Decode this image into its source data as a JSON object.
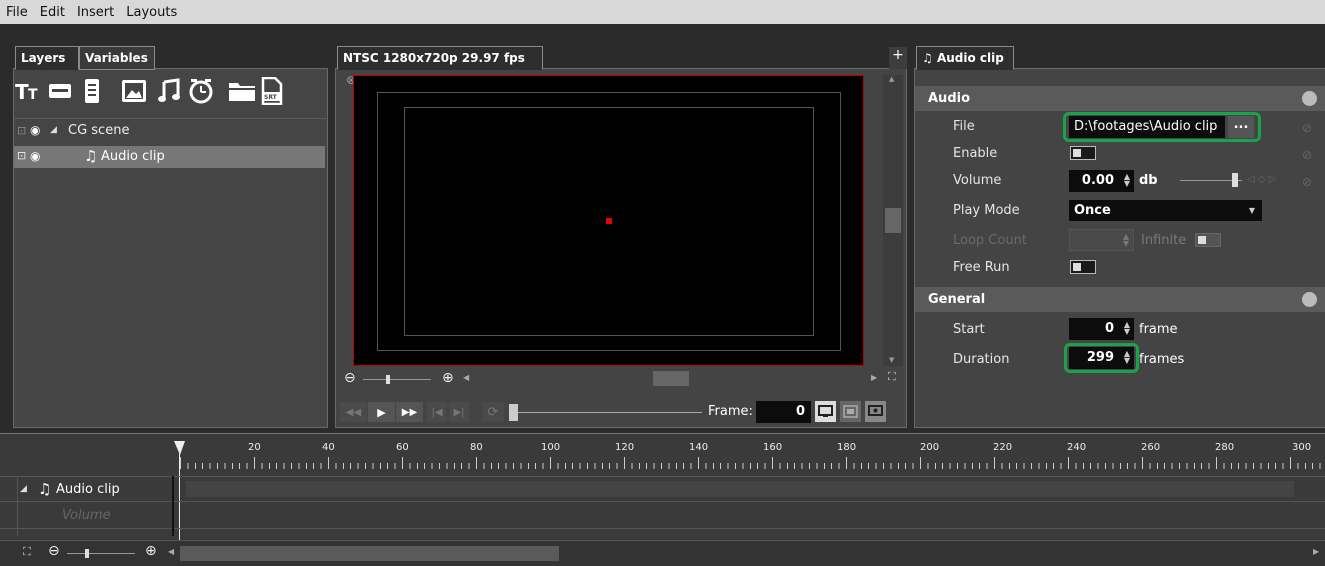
{
  "menu": {
    "items": [
      "File",
      "Edit",
      "Insert",
      "Layouts"
    ]
  },
  "left_tabs": {
    "layers": "Layers",
    "variables": "Variables"
  },
  "layers": {
    "scene": {
      "label": "CG scene"
    },
    "clip": {
      "label": "Audio clip"
    }
  },
  "preview": {
    "tab_label": "NTSC 1280x720p 29.97 fps",
    "add_tab": "+",
    "frame_label": "Frame:",
    "frame_value": "0"
  },
  "props": {
    "tab_label": "Audio clip",
    "audio_section": "Audio",
    "general_section": "General",
    "file_label": "File",
    "file_value": "D:\\footages\\Audio clip",
    "browse_label": "...",
    "enable_label": "Enable",
    "volume_label": "Volume",
    "volume_value": "0.00",
    "volume_unit": "db",
    "playmode_label": "Play Mode",
    "playmode_value": "Once",
    "loopcount_label": "Loop Count",
    "infinite_label": "Infinite",
    "freerun_label": "Free Run",
    "start_label": "Start",
    "start_value": "0",
    "start_unit": "frame",
    "duration_label": "Duration",
    "duration_value": "299",
    "duration_unit": "frames"
  },
  "timeline": {
    "ticks": [
      "20",
      "40",
      "60",
      "80",
      "100",
      "120",
      "140",
      "160",
      "180",
      "200",
      "220",
      "240",
      "260",
      "280",
      "300"
    ],
    "track_label": "Audio clip",
    "sub_track_label": "Volume"
  },
  "colors": {
    "highlight": "#1aa34a",
    "selection": "#777777",
    "marker": "#e00000"
  }
}
